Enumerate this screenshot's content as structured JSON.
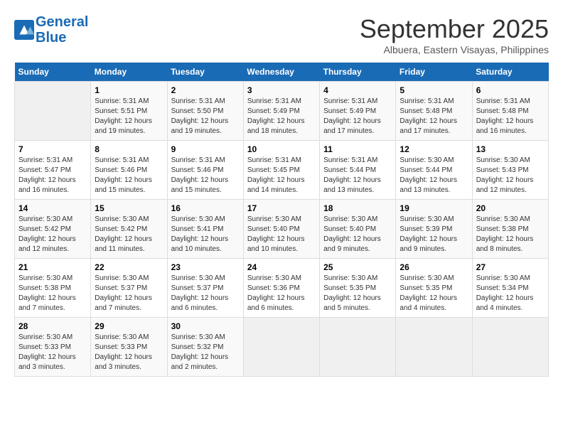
{
  "header": {
    "logo_line1": "General",
    "logo_line2": "Blue",
    "month_title": "September 2025",
    "subtitle": "Albuera, Eastern Visayas, Philippines"
  },
  "days_of_week": [
    "Sunday",
    "Monday",
    "Tuesday",
    "Wednesday",
    "Thursday",
    "Friday",
    "Saturday"
  ],
  "weeks": [
    [
      {
        "day": "",
        "info": ""
      },
      {
        "day": "1",
        "info": "Sunrise: 5:31 AM\nSunset: 5:51 PM\nDaylight: 12 hours\nand 19 minutes."
      },
      {
        "day": "2",
        "info": "Sunrise: 5:31 AM\nSunset: 5:50 PM\nDaylight: 12 hours\nand 19 minutes."
      },
      {
        "day": "3",
        "info": "Sunrise: 5:31 AM\nSunset: 5:49 PM\nDaylight: 12 hours\nand 18 minutes."
      },
      {
        "day": "4",
        "info": "Sunrise: 5:31 AM\nSunset: 5:49 PM\nDaylight: 12 hours\nand 17 minutes."
      },
      {
        "day": "5",
        "info": "Sunrise: 5:31 AM\nSunset: 5:48 PM\nDaylight: 12 hours\nand 17 minutes."
      },
      {
        "day": "6",
        "info": "Sunrise: 5:31 AM\nSunset: 5:48 PM\nDaylight: 12 hours\nand 16 minutes."
      }
    ],
    [
      {
        "day": "7",
        "info": "Sunrise: 5:31 AM\nSunset: 5:47 PM\nDaylight: 12 hours\nand 16 minutes."
      },
      {
        "day": "8",
        "info": "Sunrise: 5:31 AM\nSunset: 5:46 PM\nDaylight: 12 hours\nand 15 minutes."
      },
      {
        "day": "9",
        "info": "Sunrise: 5:31 AM\nSunset: 5:46 PM\nDaylight: 12 hours\nand 15 minutes."
      },
      {
        "day": "10",
        "info": "Sunrise: 5:31 AM\nSunset: 5:45 PM\nDaylight: 12 hours\nand 14 minutes."
      },
      {
        "day": "11",
        "info": "Sunrise: 5:31 AM\nSunset: 5:44 PM\nDaylight: 12 hours\nand 13 minutes."
      },
      {
        "day": "12",
        "info": "Sunrise: 5:30 AM\nSunset: 5:44 PM\nDaylight: 12 hours\nand 13 minutes."
      },
      {
        "day": "13",
        "info": "Sunrise: 5:30 AM\nSunset: 5:43 PM\nDaylight: 12 hours\nand 12 minutes."
      }
    ],
    [
      {
        "day": "14",
        "info": "Sunrise: 5:30 AM\nSunset: 5:42 PM\nDaylight: 12 hours\nand 12 minutes."
      },
      {
        "day": "15",
        "info": "Sunrise: 5:30 AM\nSunset: 5:42 PM\nDaylight: 12 hours\nand 11 minutes."
      },
      {
        "day": "16",
        "info": "Sunrise: 5:30 AM\nSunset: 5:41 PM\nDaylight: 12 hours\nand 10 minutes."
      },
      {
        "day": "17",
        "info": "Sunrise: 5:30 AM\nSunset: 5:40 PM\nDaylight: 12 hours\nand 10 minutes."
      },
      {
        "day": "18",
        "info": "Sunrise: 5:30 AM\nSunset: 5:40 PM\nDaylight: 12 hours\nand 9 minutes."
      },
      {
        "day": "19",
        "info": "Sunrise: 5:30 AM\nSunset: 5:39 PM\nDaylight: 12 hours\nand 9 minutes."
      },
      {
        "day": "20",
        "info": "Sunrise: 5:30 AM\nSunset: 5:38 PM\nDaylight: 12 hours\nand 8 minutes."
      }
    ],
    [
      {
        "day": "21",
        "info": "Sunrise: 5:30 AM\nSunset: 5:38 PM\nDaylight: 12 hours\nand 7 minutes."
      },
      {
        "day": "22",
        "info": "Sunrise: 5:30 AM\nSunset: 5:37 PM\nDaylight: 12 hours\nand 7 minutes."
      },
      {
        "day": "23",
        "info": "Sunrise: 5:30 AM\nSunset: 5:37 PM\nDaylight: 12 hours\nand 6 minutes."
      },
      {
        "day": "24",
        "info": "Sunrise: 5:30 AM\nSunset: 5:36 PM\nDaylight: 12 hours\nand 6 minutes."
      },
      {
        "day": "25",
        "info": "Sunrise: 5:30 AM\nSunset: 5:35 PM\nDaylight: 12 hours\nand 5 minutes."
      },
      {
        "day": "26",
        "info": "Sunrise: 5:30 AM\nSunset: 5:35 PM\nDaylight: 12 hours\nand 4 minutes."
      },
      {
        "day": "27",
        "info": "Sunrise: 5:30 AM\nSunset: 5:34 PM\nDaylight: 12 hours\nand 4 minutes."
      }
    ],
    [
      {
        "day": "28",
        "info": "Sunrise: 5:30 AM\nSunset: 5:33 PM\nDaylight: 12 hours\nand 3 minutes."
      },
      {
        "day": "29",
        "info": "Sunrise: 5:30 AM\nSunset: 5:33 PM\nDaylight: 12 hours\nand 3 minutes."
      },
      {
        "day": "30",
        "info": "Sunrise: 5:30 AM\nSunset: 5:32 PM\nDaylight: 12 hours\nand 2 minutes."
      },
      {
        "day": "",
        "info": ""
      },
      {
        "day": "",
        "info": ""
      },
      {
        "day": "",
        "info": ""
      },
      {
        "day": "",
        "info": ""
      }
    ]
  ]
}
